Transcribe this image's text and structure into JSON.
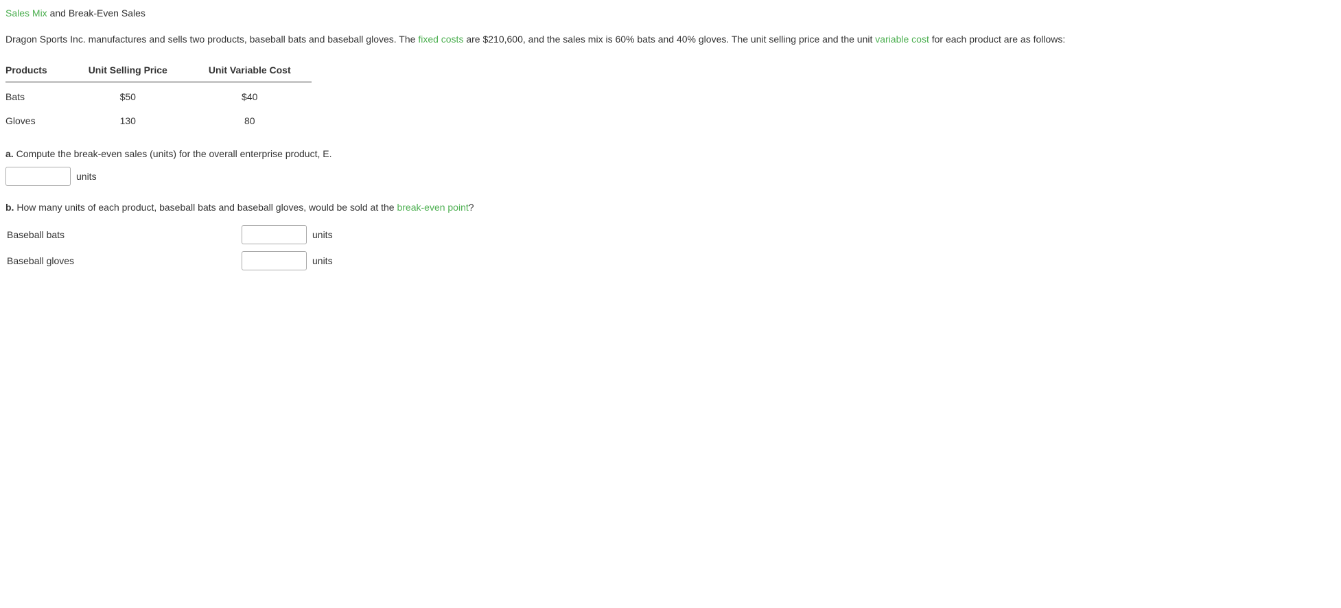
{
  "title": {
    "linked": "Sales Mix",
    "rest": " and Break-Even Sales"
  },
  "intro": {
    "part1": "Dragon Sports Inc. manufactures and sells two products, baseball bats and baseball gloves. The ",
    "link1": "fixed costs",
    "part2": " are $210,600, and the sales mix is 60% bats and 40% gloves. The unit selling price and the unit ",
    "link2": "variable cost",
    "part3": " for each product are as follows:"
  },
  "table": {
    "headers": {
      "products": "Products",
      "price": "Unit Selling Price",
      "cost": "Unit Variable Cost"
    },
    "rows": [
      {
        "product": "Bats",
        "price": "$50",
        "cost": "$40"
      },
      {
        "product": "Gloves",
        "price": "130",
        "cost": "80"
      }
    ]
  },
  "question_a": {
    "label": "a.",
    "text": "  Compute the break-even sales (units) for the overall enterprise product, E.",
    "units": "units"
  },
  "question_b": {
    "label": "b.",
    "text_part1": "  How many units of each product, baseball bats and baseball gloves, would be sold at the ",
    "link": "break-even point",
    "text_part2": "?",
    "rows": [
      {
        "label": "Baseball bats",
        "units": "units"
      },
      {
        "label": "Baseball gloves",
        "units": "units"
      }
    ]
  }
}
